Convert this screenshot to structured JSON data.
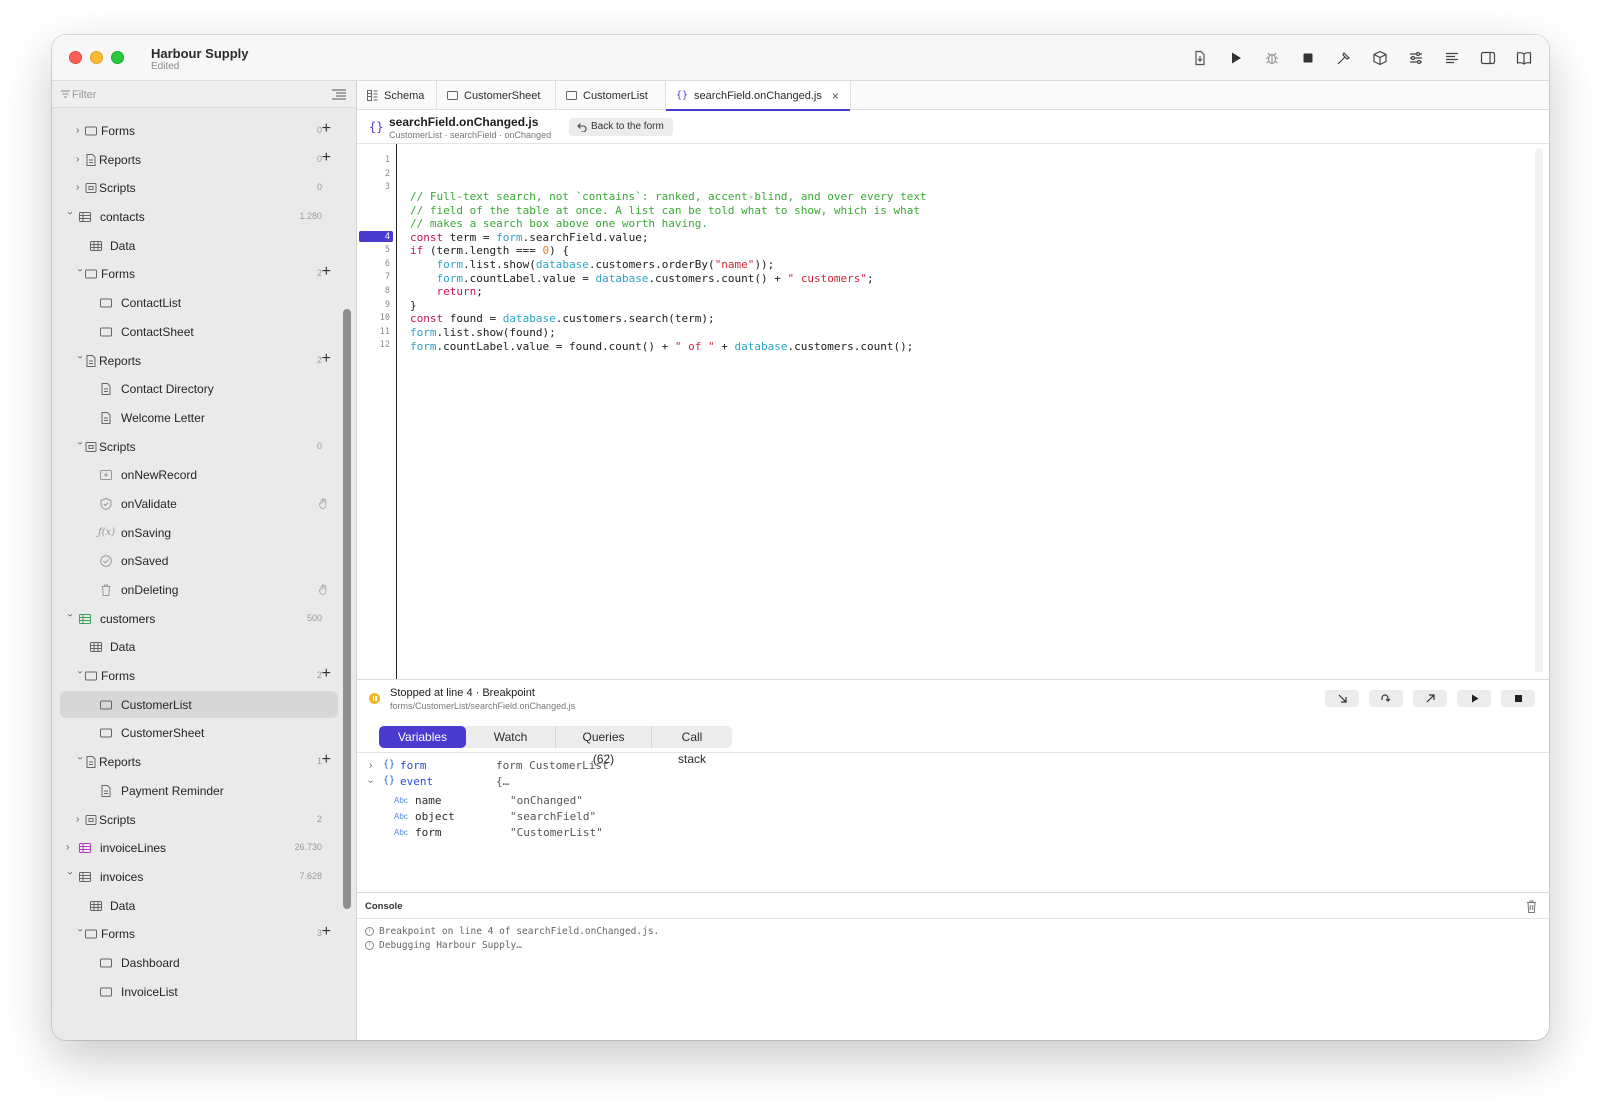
{
  "app": {
    "title": "Harbour Supply",
    "subtitle": "Edited"
  },
  "toolbar": [
    "export-icon",
    "run-icon",
    "debug-bug-icon",
    "stop-icon",
    "build-hammer-icon",
    "package-icon",
    "settings-sliders-icon",
    "align-left-icon",
    "split-view-icon",
    "book-icon"
  ],
  "sidebar": {
    "filter_placeholder": "Filter",
    "rows": [
      {
        "label": "Forms",
        "count": "0",
        "plus": true
      },
      {
        "label": "Reports",
        "count": "0",
        "plus": true
      },
      {
        "label": "Scripts",
        "count": "0"
      },
      {
        "label": "contacts",
        "count": "1.280"
      },
      {
        "label": "Data"
      },
      {
        "label": "Forms",
        "count": "2",
        "plus": true
      },
      {
        "label": "ContactList"
      },
      {
        "label": "ContactSheet"
      },
      {
        "label": "Reports",
        "count": "2",
        "plus": true
      },
      {
        "label": "Contact Directory"
      },
      {
        "label": "Welcome Letter"
      },
      {
        "label": "Scripts",
        "count": "0"
      },
      {
        "label": "onNewRecord"
      },
      {
        "label": "onValidate"
      },
      {
        "label": "onSaving"
      },
      {
        "label": "onSaved"
      },
      {
        "label": "onDeleting"
      },
      {
        "label": "customers",
        "count": "500"
      },
      {
        "label": "Data"
      },
      {
        "label": "Forms",
        "count": "2",
        "plus": true
      },
      {
        "label": "CustomerList"
      },
      {
        "label": "CustomerSheet"
      },
      {
        "label": "Reports",
        "count": "1",
        "plus": true
      },
      {
        "label": "Payment Reminder"
      },
      {
        "label": "Scripts",
        "count": "2"
      },
      {
        "label": "invoiceLines",
        "count": "26.730"
      },
      {
        "label": "invoices",
        "count": "7.628"
      },
      {
        "label": "Data"
      },
      {
        "label": "Forms",
        "count": "3",
        "plus": true
      },
      {
        "label": "Dashboard"
      },
      {
        "label": "InvoiceList"
      }
    ]
  },
  "tabs": [
    {
      "label": "Schema"
    },
    {
      "label": "CustomerSheet"
    },
    {
      "label": "CustomerList"
    },
    {
      "label": "searchField.onChanged.js",
      "active": true
    }
  ],
  "file": {
    "title": "searchField.onChanged.js",
    "path": "CustomerList · searchField · onChanged",
    "back_label": "Back to the form"
  },
  "editor": {
    "breakpoint_line": 4,
    "line_numbers": [
      "1",
      "2",
      "3",
      "4",
      "5",
      "6",
      "7",
      "8",
      "9",
      "10",
      "11",
      "12"
    ]
  },
  "debug": {
    "status": "Stopped at line 4 · Breakpoint",
    "path": "forms/CustomerList/searchField.onChanged.js",
    "controls": [
      "step-into-icon",
      "step-over-icon",
      "step-out-icon",
      "continue-icon",
      "stop-icon"
    ],
    "tabs": [
      "Variables",
      "Watch",
      "Queries (62)",
      "Call stack"
    ],
    "active_tab": "Variables",
    "variables": [
      {
        "name": "form",
        "value": "form CustomerList"
      },
      {
        "name": "event",
        "value": "{…"
      },
      {
        "name": "name",
        "value": "\"onChanged\""
      },
      {
        "name": "object",
        "value": "\"searchField\""
      },
      {
        "name": "form",
        "value": "\"CustomerList\""
      }
    ]
  },
  "console": {
    "title": "Console",
    "lines": [
      "Breakpoint on line 4 of searchField.onChanged.js.",
      "Debugging Harbour Supply…"
    ]
  },
  "colors": {
    "accent": "#4a3bd0",
    "comment": "#3aa935",
    "keyword": "#c8174d",
    "object": "#2aa5c7",
    "string": "#d1283a",
    "number": "#e0842c"
  }
}
